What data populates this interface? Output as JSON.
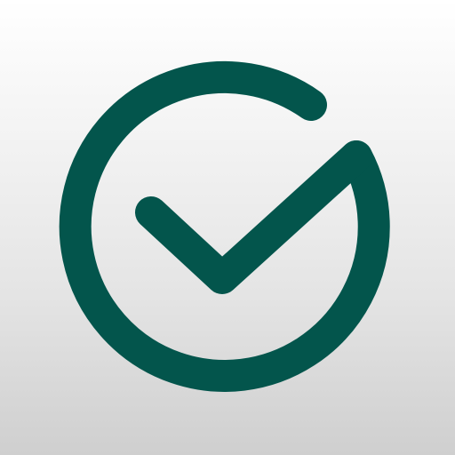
{
  "app_icon": {
    "icon": "check-circle-icon",
    "colors": {
      "mark": "#03554c",
      "background_top": "#ffffff",
      "background_bottom": "#cfcfcf"
    }
  }
}
